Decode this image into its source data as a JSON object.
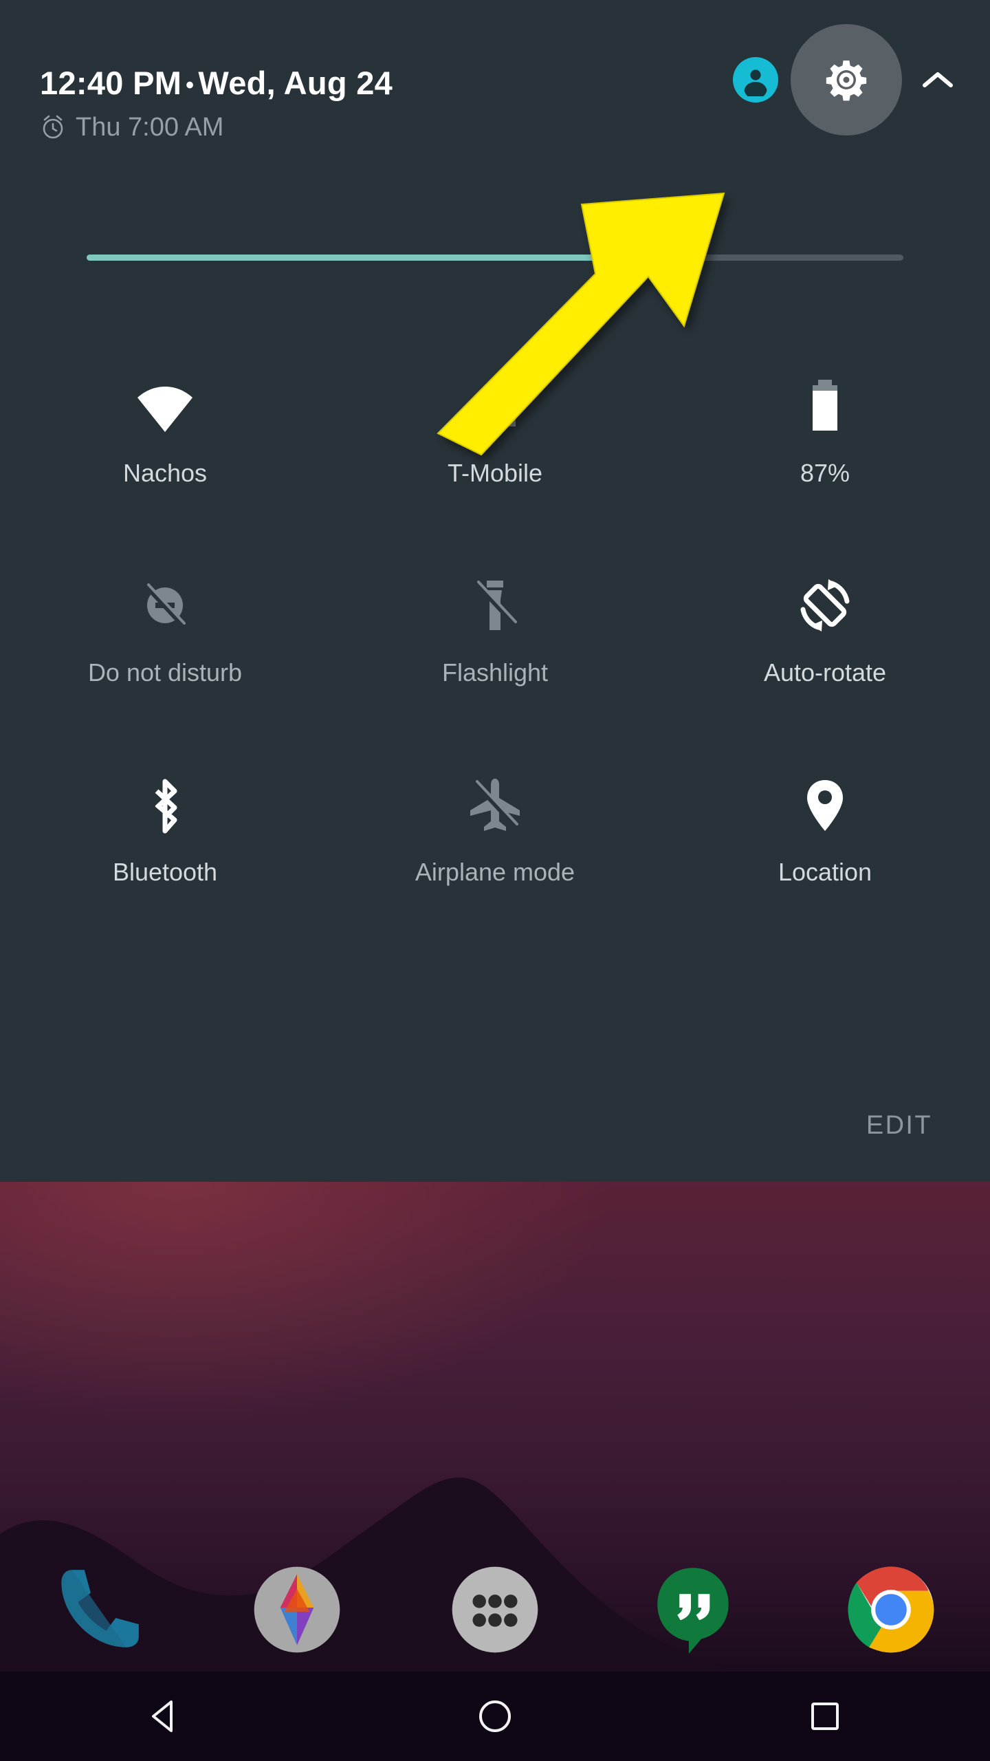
{
  "header": {
    "time": "12:40 PM",
    "separator": "•",
    "date": "Wed, Aug 24",
    "alarm": "Thu 7:00 AM",
    "alarm_icon": "alarm-clock-icon",
    "avatar_icon": "user-avatar-icon",
    "settings_icon": "gear-icon",
    "collapse_icon": "chevron-up-icon",
    "avatar_color": "#15bcd4",
    "settings_highlight_color": "#596066"
  },
  "brightness": {
    "label": "brightness-slider",
    "value_percent": 67,
    "fill_color": "#80c7c0",
    "track_color": "#4e5a60",
    "thumb_icon": "brightness-icon"
  },
  "tiles": [
    [
      {
        "label": "Nachos",
        "icon": "wifi-icon",
        "state": "on"
      },
      {
        "label": "T-Mobile",
        "icon": "cell-signal-icon",
        "state": "on"
      },
      {
        "label": "87%",
        "icon": "battery-icon",
        "state": "on"
      }
    ],
    [
      {
        "label": "Do not disturb",
        "icon": "do-not-disturb-icon",
        "state": "off"
      },
      {
        "label": "Flashlight",
        "icon": "flashlight-icon",
        "state": "off"
      },
      {
        "label": "Auto-rotate",
        "icon": "auto-rotate-icon",
        "state": "on"
      }
    ],
    [
      {
        "label": "Bluetooth",
        "icon": "bluetooth-icon",
        "state": "on"
      },
      {
        "label": "Airplane mode",
        "icon": "airplane-icon",
        "state": "off"
      },
      {
        "label": "Location",
        "icon": "location-pin-icon",
        "state": "on"
      }
    ]
  ],
  "edit_button": {
    "label": "EDIT"
  },
  "dock": [
    {
      "name": "Phone",
      "icon": "phone-icon"
    },
    {
      "name": "Photos",
      "icon": "photos-icon"
    },
    {
      "name": "All apps",
      "icon": "app-drawer-icon"
    },
    {
      "name": "Hangouts",
      "icon": "hangouts-icon"
    },
    {
      "name": "Chrome",
      "icon": "chrome-icon"
    }
  ],
  "navbar": [
    {
      "name": "Back",
      "icon": "back-triangle-icon"
    },
    {
      "name": "Home",
      "icon": "home-circle-icon"
    },
    {
      "name": "Recents",
      "icon": "recents-square-icon"
    }
  ],
  "annotation": {
    "type": "arrow",
    "color": "#ffee00",
    "points_to": "settings-gear-button"
  },
  "colors": {
    "panel_background": "#283339",
    "tile_label": "#d4dadd",
    "tile_label_off": "#aab3b8",
    "alarm_text": "#93a0a6",
    "edit_text": "#8b979d",
    "navbar_background": "#0e0614"
  }
}
